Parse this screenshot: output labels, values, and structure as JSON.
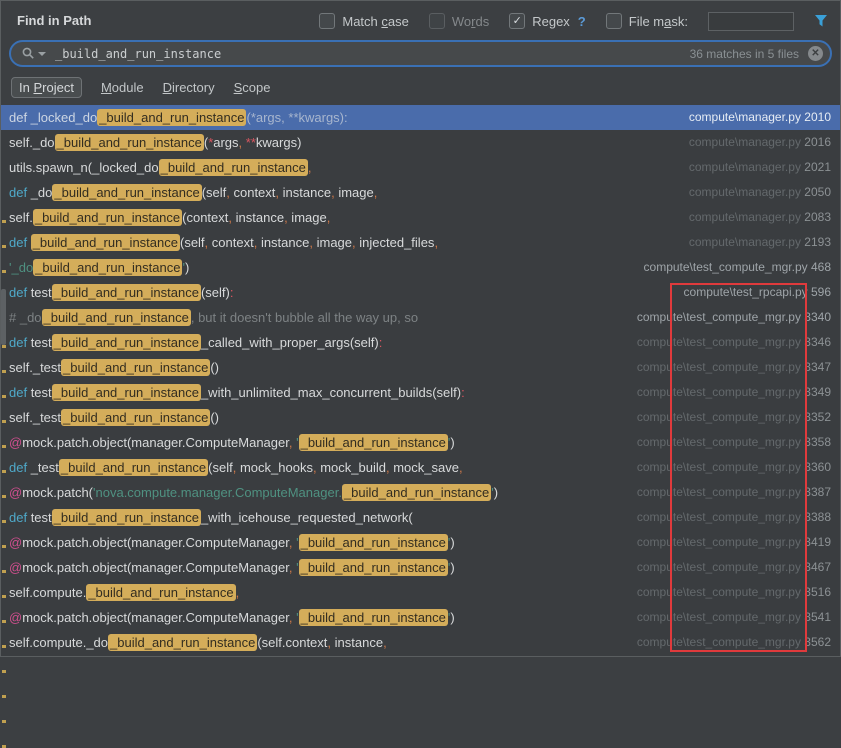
{
  "window": {
    "title": "Find in Path"
  },
  "options": {
    "match_case": {
      "pre": "Match ",
      "mn": "c",
      "post": "ase",
      "checked": false,
      "enabled": true
    },
    "words": {
      "pre": "Wo",
      "mn": "r",
      "post": "ds",
      "checked": false,
      "enabled": false
    },
    "regex": {
      "pre": "Re",
      "mn": "g",
      "post": "ex",
      "checked": true,
      "enabled": true,
      "check_glyph": "✓",
      "help": "?"
    },
    "file_mask": {
      "pre": "File m",
      "mn": "a",
      "post": "sk:",
      "checked": false,
      "enabled": true,
      "value": "",
      "placeholder": ""
    }
  },
  "search": {
    "value": "_build_and_run_instance",
    "matches_label": "36 matches in 5 files",
    "clear_glyph": "✕"
  },
  "scope_tabs": [
    {
      "pre": "In ",
      "mn": "P",
      "post": "roject",
      "selected": true
    },
    {
      "pre": "",
      "mn": "M",
      "post": "odule",
      "selected": false
    },
    {
      "pre": "",
      "mn": "D",
      "post": "irectory",
      "selected": false
    },
    {
      "pre": "",
      "mn": "S",
      "post": "cope",
      "selected": false
    }
  ],
  "colors": {
    "selection_blue": "#4a6cab",
    "match_highlight_bg": "#d4ad5a",
    "match_highlight_text": "#332d20",
    "keyword_cyan": "#4fa9c9",
    "string_green": "#4f9181",
    "comma_orange": "#cd7849",
    "decorator_pink": "#cf4f8e",
    "comment_gray": "#7d8284",
    "annotation_red": "#e03a3c",
    "focus_border_blue": "#3a70b4",
    "filter_icon_blue": "#3aa0d8"
  },
  "results": {
    "rows": [
      {
        "selected": true,
        "bright": false,
        "path": "compute\\manager.py",
        "line": "2010",
        "segments": [
          [
            "w",
            "def _locked_do"
          ],
          [
            "m",
            "_build_and_run_instance"
          ],
          [
            "d",
            "(*args, **kwargs):"
          ]
        ]
      },
      {
        "selected": false,
        "bright": false,
        "path": "compute\\manager.py",
        "line": "2016",
        "segments": [
          [
            "t",
            "self._do"
          ],
          [
            "m",
            "_build_and_run_instance"
          ],
          [
            "t",
            "("
          ],
          [
            "a",
            "*"
          ],
          [
            "t",
            "args"
          ],
          [
            "p",
            ","
          ],
          [
            "t",
            " "
          ],
          [
            "a",
            "**"
          ],
          [
            "t",
            "kwargs)"
          ]
        ]
      },
      {
        "selected": false,
        "bright": false,
        "path": "compute\\manager.py",
        "line": "2021",
        "segments": [
          [
            "t",
            "utils.spawn_n(_locked_do"
          ],
          [
            "m",
            "_build_and_run_instance"
          ],
          [
            "p",
            ","
          ]
        ]
      },
      {
        "selected": false,
        "bright": false,
        "path": "compute\\manager.py",
        "line": "2050",
        "segments": [
          [
            "k",
            "def "
          ],
          [
            "t",
            "_do"
          ],
          [
            "m",
            "_build_and_run_instance"
          ],
          [
            "t",
            "(self"
          ],
          [
            "p",
            ","
          ],
          [
            "t",
            " context"
          ],
          [
            "p",
            ","
          ],
          [
            "t",
            " instance"
          ],
          [
            "p",
            ","
          ],
          [
            "t",
            " image"
          ],
          [
            "p",
            ","
          ]
        ]
      },
      {
        "selected": false,
        "bright": false,
        "path": "compute\\manager.py",
        "line": "2083",
        "segments": [
          [
            "t",
            "self."
          ],
          [
            "m",
            "_build_and_run_instance"
          ],
          [
            "t",
            "(context"
          ],
          [
            "p",
            ","
          ],
          [
            "t",
            " instance"
          ],
          [
            "p",
            ","
          ],
          [
            "t",
            " image"
          ],
          [
            "p",
            ","
          ]
        ]
      },
      {
        "selected": false,
        "bright": false,
        "path": "compute\\manager.py",
        "line": "2193",
        "segments": [
          [
            "k",
            "def "
          ],
          [
            "m",
            "_build_and_run_instance"
          ],
          [
            "t",
            "(self"
          ],
          [
            "p",
            ","
          ],
          [
            "t",
            " context"
          ],
          [
            "p",
            ","
          ],
          [
            "t",
            " instance"
          ],
          [
            "p",
            ","
          ],
          [
            "t",
            " image"
          ],
          [
            "p",
            ","
          ],
          [
            "t",
            " injected_files"
          ],
          [
            "p",
            ","
          ]
        ]
      },
      {
        "selected": false,
        "bright": true,
        "path": "compute\\test_compute_mgr.py",
        "line": "468",
        "segments": [
          [
            "s",
            "'_do"
          ],
          [
            "m",
            "_build_and_run_instance"
          ],
          [
            "s",
            "'"
          ],
          [
            "t",
            ")"
          ]
        ]
      },
      {
        "selected": false,
        "bright": true,
        "path": "compute\\test_rpcapi.py",
        "line": "596",
        "segments": [
          [
            "k",
            "def "
          ],
          [
            "t",
            "test"
          ],
          [
            "m",
            "_build_and_run_instance"
          ],
          [
            "t",
            "(self)"
          ],
          [
            "a",
            ":"
          ]
        ]
      },
      {
        "selected": false,
        "bright": true,
        "path": "compute\\test_compute_mgr.py",
        "line": "3340",
        "segments": [
          [
            "c",
            "# _do"
          ],
          [
            "m",
            "_build_and_run_instance"
          ],
          [
            "c",
            ", but it doesn't bubble all the way up, so"
          ]
        ]
      },
      {
        "selected": false,
        "bright": false,
        "path": "compute\\test_compute_mgr.py",
        "line": "3346",
        "segments": [
          [
            "k",
            "def "
          ],
          [
            "t",
            "test"
          ],
          [
            "m",
            "_build_and_run_instance"
          ],
          [
            "t",
            "_called_with_proper_args(self)"
          ],
          [
            "a",
            ":"
          ]
        ]
      },
      {
        "selected": false,
        "bright": false,
        "path": "compute\\test_compute_mgr.py",
        "line": "3347",
        "segments": [
          [
            "t",
            "self._test"
          ],
          [
            "m",
            "_build_and_run_instance"
          ],
          [
            "t",
            "()"
          ]
        ]
      },
      {
        "selected": false,
        "bright": false,
        "path": "compute\\test_compute_mgr.py",
        "line": "3349",
        "segments": [
          [
            "k",
            "def "
          ],
          [
            "t",
            "test"
          ],
          [
            "m",
            "_build_and_run_instance"
          ],
          [
            "t",
            "_with_unlimited_max_concurrent_builds(self)"
          ],
          [
            "a",
            ":"
          ]
        ]
      },
      {
        "selected": false,
        "bright": false,
        "path": "compute\\test_compute_mgr.py",
        "line": "3352",
        "segments": [
          [
            "t",
            "self._test"
          ],
          [
            "m",
            "_build_and_run_instance"
          ],
          [
            "t",
            "()"
          ]
        ]
      },
      {
        "selected": false,
        "bright": false,
        "path": "compute\\test_compute_mgr.py",
        "line": "3358",
        "segments": [
          [
            "e",
            "@"
          ],
          [
            "t",
            "mock.patch.object(manager.ComputeManager"
          ],
          [
            "p",
            ","
          ],
          [
            "t",
            " "
          ],
          [
            "s",
            "'"
          ],
          [
            "m",
            "_build_and_run_instance"
          ],
          [
            "s",
            "'"
          ],
          [
            "t",
            ")"
          ]
        ]
      },
      {
        "selected": false,
        "bright": false,
        "path": "compute\\test_compute_mgr.py",
        "line": "3360",
        "segments": [
          [
            "k",
            "def "
          ],
          [
            "t",
            "_test"
          ],
          [
            "m",
            "_build_and_run_instance"
          ],
          [
            "t",
            "(self"
          ],
          [
            "p",
            ","
          ],
          [
            "t",
            " mock_hooks"
          ],
          [
            "p",
            ","
          ],
          [
            "t",
            " mock_build"
          ],
          [
            "p",
            ","
          ],
          [
            "t",
            " mock_save"
          ],
          [
            "p",
            ","
          ]
        ]
      },
      {
        "selected": false,
        "bright": false,
        "path": "compute\\test_compute_mgr.py",
        "line": "3387",
        "segments": [
          [
            "e",
            "@"
          ],
          [
            "t",
            "mock.patch("
          ],
          [
            "s",
            "'nova.compute.manager.ComputeManager."
          ],
          [
            "m",
            "_build_and_run_instance"
          ],
          [
            "s",
            "'"
          ],
          [
            "t",
            ")"
          ]
        ]
      },
      {
        "selected": false,
        "bright": false,
        "path": "compute\\test_compute_mgr.py",
        "line": "3388",
        "segments": [
          [
            "k",
            "def "
          ],
          [
            "t",
            "test"
          ],
          [
            "m",
            "_build_and_run_instance"
          ],
          [
            "t",
            "_with_icehouse_requested_network("
          ]
        ]
      },
      {
        "selected": false,
        "bright": false,
        "path": "compute\\test_compute_mgr.py",
        "line": "3419",
        "segments": [
          [
            "e",
            "@"
          ],
          [
            "t",
            "mock.patch.object(manager.ComputeManager"
          ],
          [
            "p",
            ","
          ],
          [
            "t",
            " "
          ],
          [
            "s",
            "'"
          ],
          [
            "m",
            "_build_and_run_instance"
          ],
          [
            "s",
            "'"
          ],
          [
            "t",
            ")"
          ]
        ]
      },
      {
        "selected": false,
        "bright": false,
        "path": "compute\\test_compute_mgr.py",
        "line": "3467",
        "segments": [
          [
            "e",
            "@"
          ],
          [
            "t",
            "mock.patch.object(manager.ComputeManager"
          ],
          [
            "p",
            ","
          ],
          [
            "t",
            " "
          ],
          [
            "s",
            "'"
          ],
          [
            "m",
            "_build_and_run_instance"
          ],
          [
            "s",
            "'"
          ],
          [
            "t",
            ")"
          ]
        ]
      },
      {
        "selected": false,
        "bright": false,
        "path": "compute\\test_compute_mgr.py",
        "line": "3516",
        "segments": [
          [
            "t",
            "self.compute."
          ],
          [
            "m",
            "_build_and_run_instance"
          ],
          [
            "p",
            ","
          ]
        ]
      },
      {
        "selected": false,
        "bright": false,
        "path": "compute\\test_compute_mgr.py",
        "line": "3541",
        "segments": [
          [
            "e",
            "@"
          ],
          [
            "t",
            "mock.patch.object(manager.ComputeManager"
          ],
          [
            "p",
            ","
          ],
          [
            "t",
            " "
          ],
          [
            "s",
            "'"
          ],
          [
            "m",
            "_build_and_run_instance"
          ],
          [
            "s",
            "'"
          ],
          [
            "t",
            ")"
          ]
        ]
      },
      {
        "selected": false,
        "bright": false,
        "path": "compute\\test_compute_mgr.py",
        "line": "3562",
        "segments": [
          [
            "t",
            "self.compute._do"
          ],
          [
            "m",
            "_build_and_run_instance"
          ],
          [
            "t",
            "(self.context"
          ],
          [
            "p",
            ","
          ],
          [
            "t",
            " instance"
          ],
          [
            "p",
            ","
          ]
        ]
      }
    ]
  }
}
